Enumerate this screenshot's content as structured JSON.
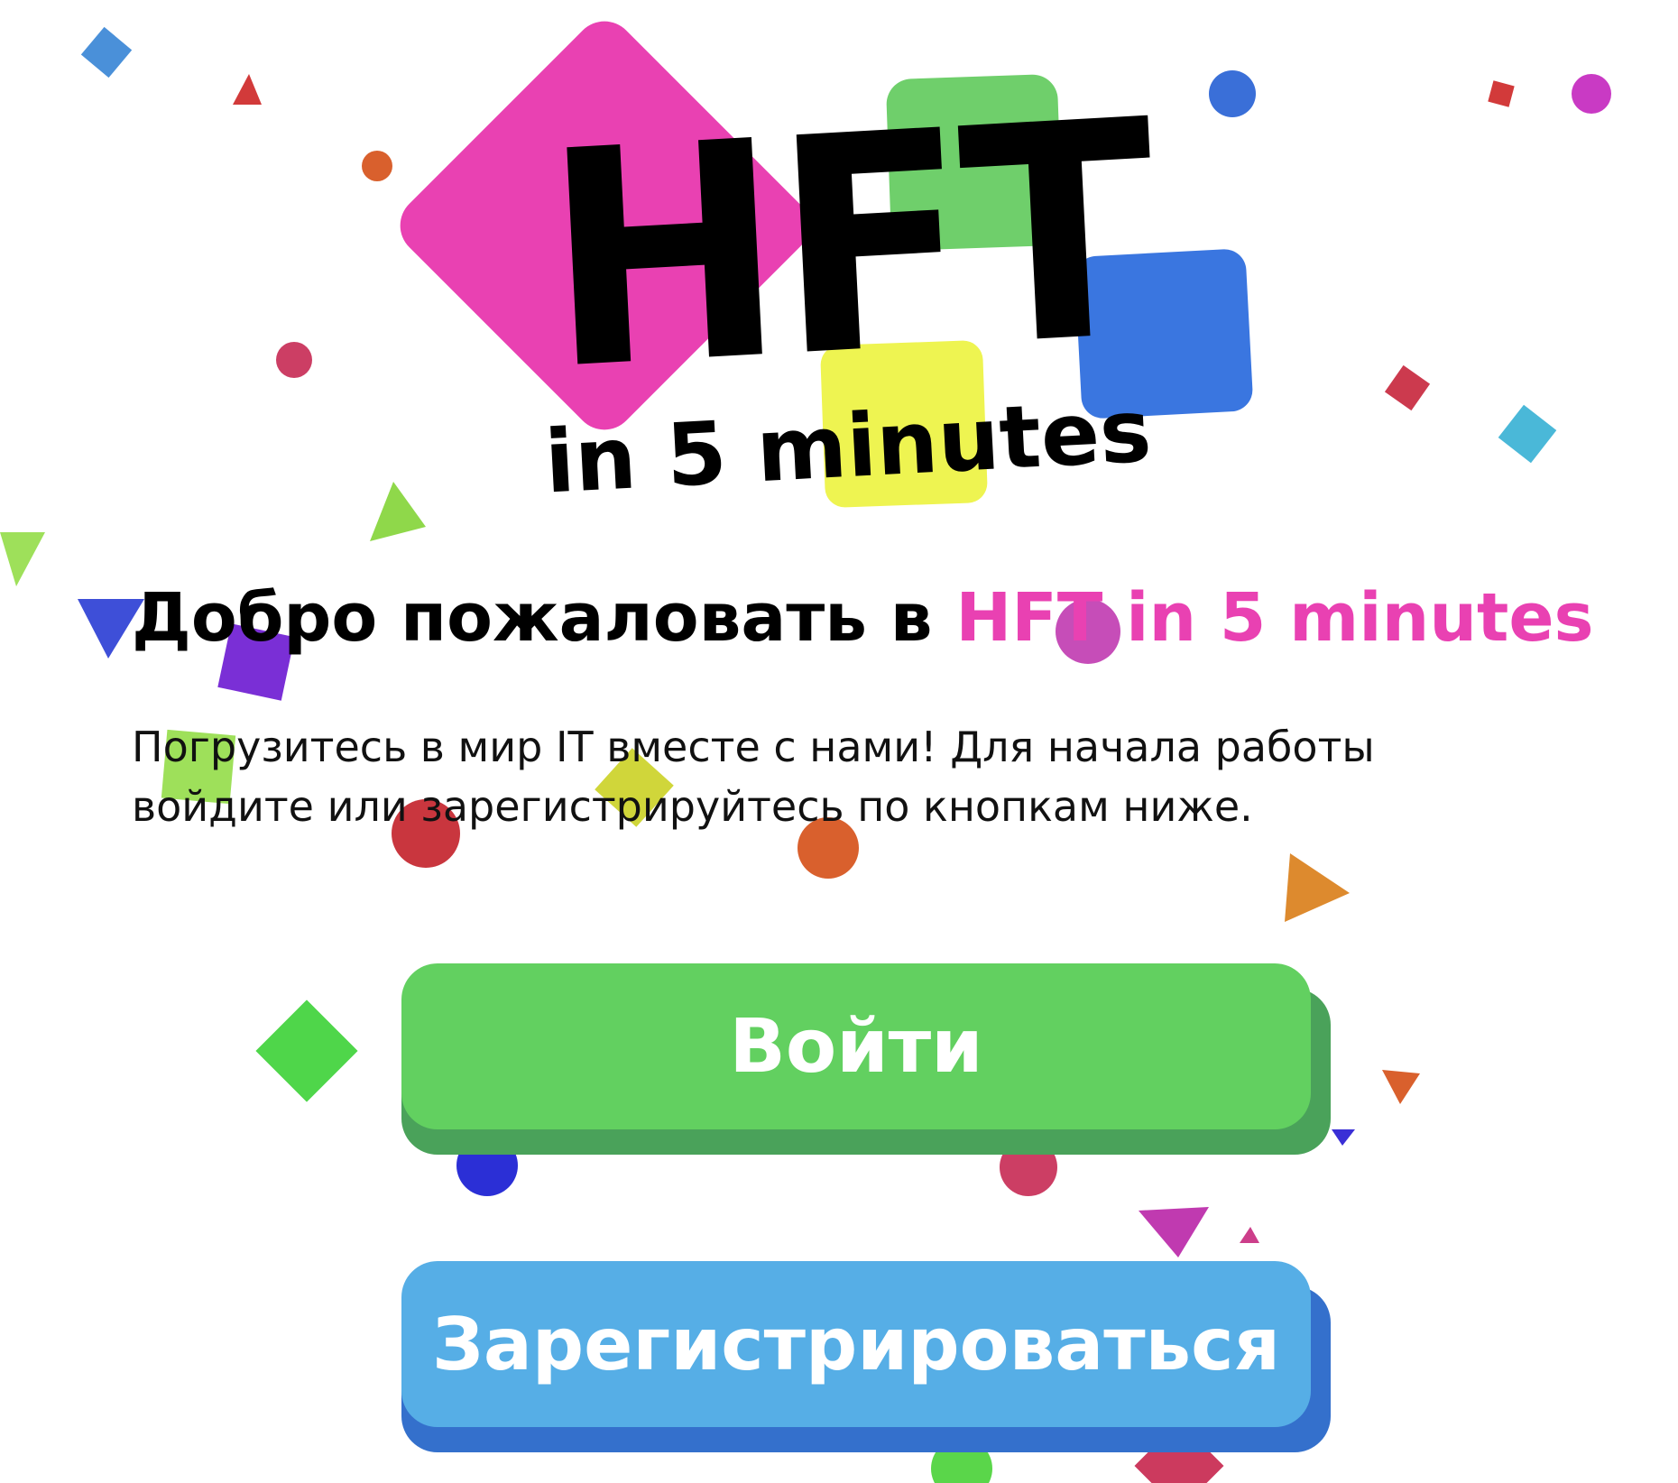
{
  "logo": {
    "title": "HFT",
    "subtitle": "in 5 minutes",
    "colors": {
      "pink": "#e941b2",
      "green": "#6fcf6b",
      "blue": "#3a76e0",
      "yellow": "#eef451"
    }
  },
  "welcome": {
    "prefix": "Добро пожаловать в ",
    "highlight": "HFT in 5 minutes",
    "highlight_color": "#e941b2"
  },
  "intro": {
    "line1": "Погрузитесь в мир IT вместе с нами! Для начала работы",
    "line2": "войдите или зарегистрируйтесь по кнопкам ниже."
  },
  "buttons": {
    "login": {
      "label": "Войти",
      "color": "#62d060"
    },
    "register": {
      "label": "Зарегистрироваться",
      "color": "#56aee6"
    }
  },
  "background": {
    "decoration": "confetti",
    "confetti_colors": [
      "#3f8fd8",
      "#d23a3a",
      "#d9602d",
      "#cc3e64",
      "#8fd84a",
      "#3e4fd8",
      "#7a2fd6",
      "#9ee05a",
      "#d0d63a",
      "#dd8a2e",
      "#4fd64a",
      "#2b2fd6",
      "#c03ab0",
      "#4ab8d8",
      "#c93ac4",
      "#5a9be0"
    ]
  }
}
